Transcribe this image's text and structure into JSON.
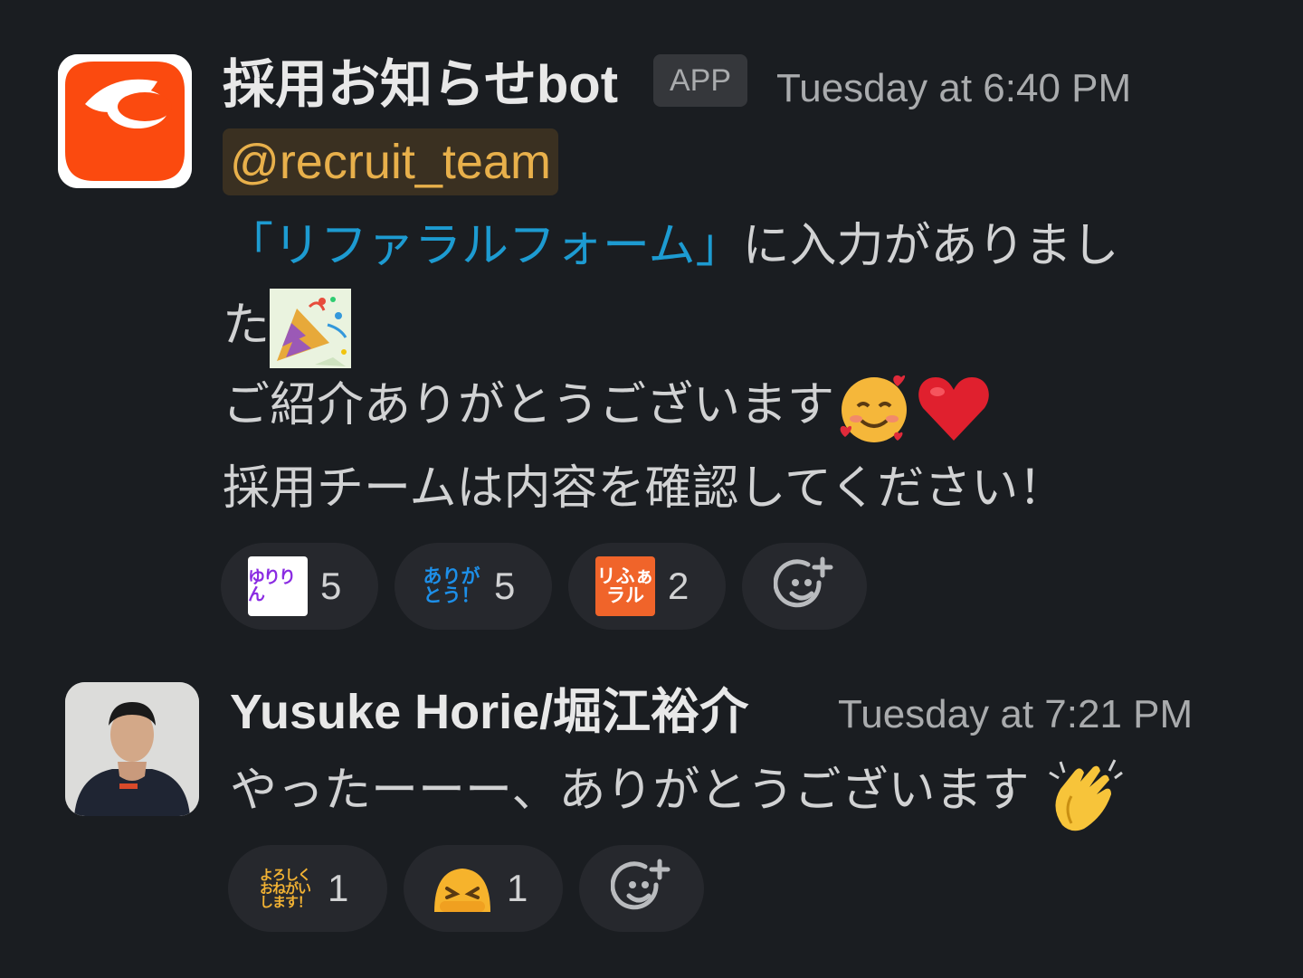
{
  "messages": [
    {
      "sender": "採用お知らせbot",
      "badge": "APP",
      "timestamp": "Tuesday at 6:40 PM",
      "avatar_icon": "orange-logo-icon",
      "mention": "@recruit_team",
      "line1_link": "「リファラルフォーム」",
      "line1_text": "に入力がありまし",
      "line2_text": "た",
      "line2_emoji": "party-popper-icon",
      "line3_text": "ご紹介ありがとうございます",
      "line3_emojis": [
        "smiling-face-with-hearts-icon",
        "red-heart-icon"
      ],
      "line4_text": "採用チームは内容を確認してください！",
      "reactions": [
        {
          "emoji": "yuririn-custom-icon",
          "label": "ゆりりん",
          "count": "5"
        },
        {
          "emoji": "arigatou-custom-icon",
          "label_top": "ありが",
          "label_bottom": "とう！",
          "count": "5"
        },
        {
          "emoji": "referral-custom-icon",
          "label_top": "リふぁ",
          "label_bottom": "ラル",
          "count": "2"
        }
      ]
    },
    {
      "sender": "Yusuke Horie/堀江裕介",
      "timestamp": "Tuesday at 7:21 PM",
      "avatar_icon": "user-photo-avatar",
      "text": "やったーーー、ありがとうございます",
      "text_emoji": "clapping-hands-icon",
      "reactions": [
        {
          "emoji": "yoroshiku-custom-icon",
          "label_l1": "よろしく",
          "label_l2": "おねがい",
          "label_l3": "します！",
          "count": "1"
        },
        {
          "emoji": "bowing-face-icon",
          "count": "1"
        }
      ]
    }
  ],
  "colors": {
    "background": "#1a1d21",
    "mention_bg": "#3a3021",
    "mention_fg": "#e8b04b",
    "link": "#1d9bd1",
    "reaction_bg": "#26282d"
  }
}
